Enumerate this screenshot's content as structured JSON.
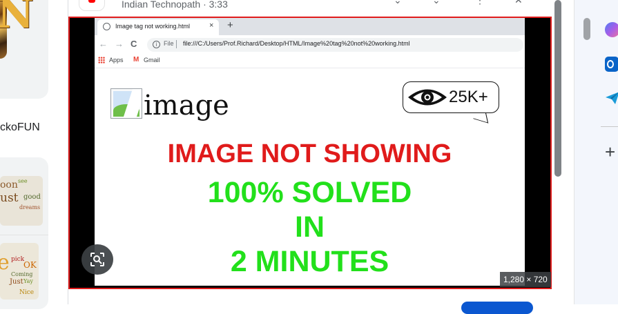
{
  "left_column": {
    "top_card_letters": "N",
    "channel_label": "ckoFUN",
    "wordcloud_top": [
      "oon",
      "see",
      "ust",
      "good",
      "dreams"
    ],
    "wordcloud_bottom": [
      "e",
      "pick",
      "OK",
      "Coming",
      "Just",
      "Yay",
      "Nice"
    ]
  },
  "result": {
    "source": "Indian Technopath · 3:33",
    "dimensions": "1,280 × 720"
  },
  "inner_browser": {
    "tab_title": "Image tag not working.html",
    "tab_close": "×",
    "new_tab": "+",
    "nav_back": "←",
    "nav_forward": "→",
    "reload": "C",
    "info_glyph": "i",
    "file_label": "File",
    "url": "file:///C:/Users/Prof.Richard/Desktop/HTML/Image%20tag%20not%20working.html",
    "bookmarks": [
      "Apps",
      "Gmail"
    ],
    "gmail_glyph": "M"
  },
  "thumbnail": {
    "broken_alt": "image",
    "views": "25K+",
    "headline_red": "IMAGE NOT SHOWING",
    "headline_green": [
      "100% SOLVED",
      "IN",
      "2 MINUTES"
    ]
  },
  "right_rail": {
    "add_glyph": "+"
  },
  "colors": {
    "red": "#e01b1b",
    "green": "#22e01b",
    "frame_border": "#e01b1b",
    "accent_blue": "#0b57d0"
  },
  "icons": [
    "youtube-icon",
    "lens-search-icon",
    "globe-icon",
    "eye-icon",
    "copilot-icon",
    "outlook-icon",
    "send-icon"
  ]
}
